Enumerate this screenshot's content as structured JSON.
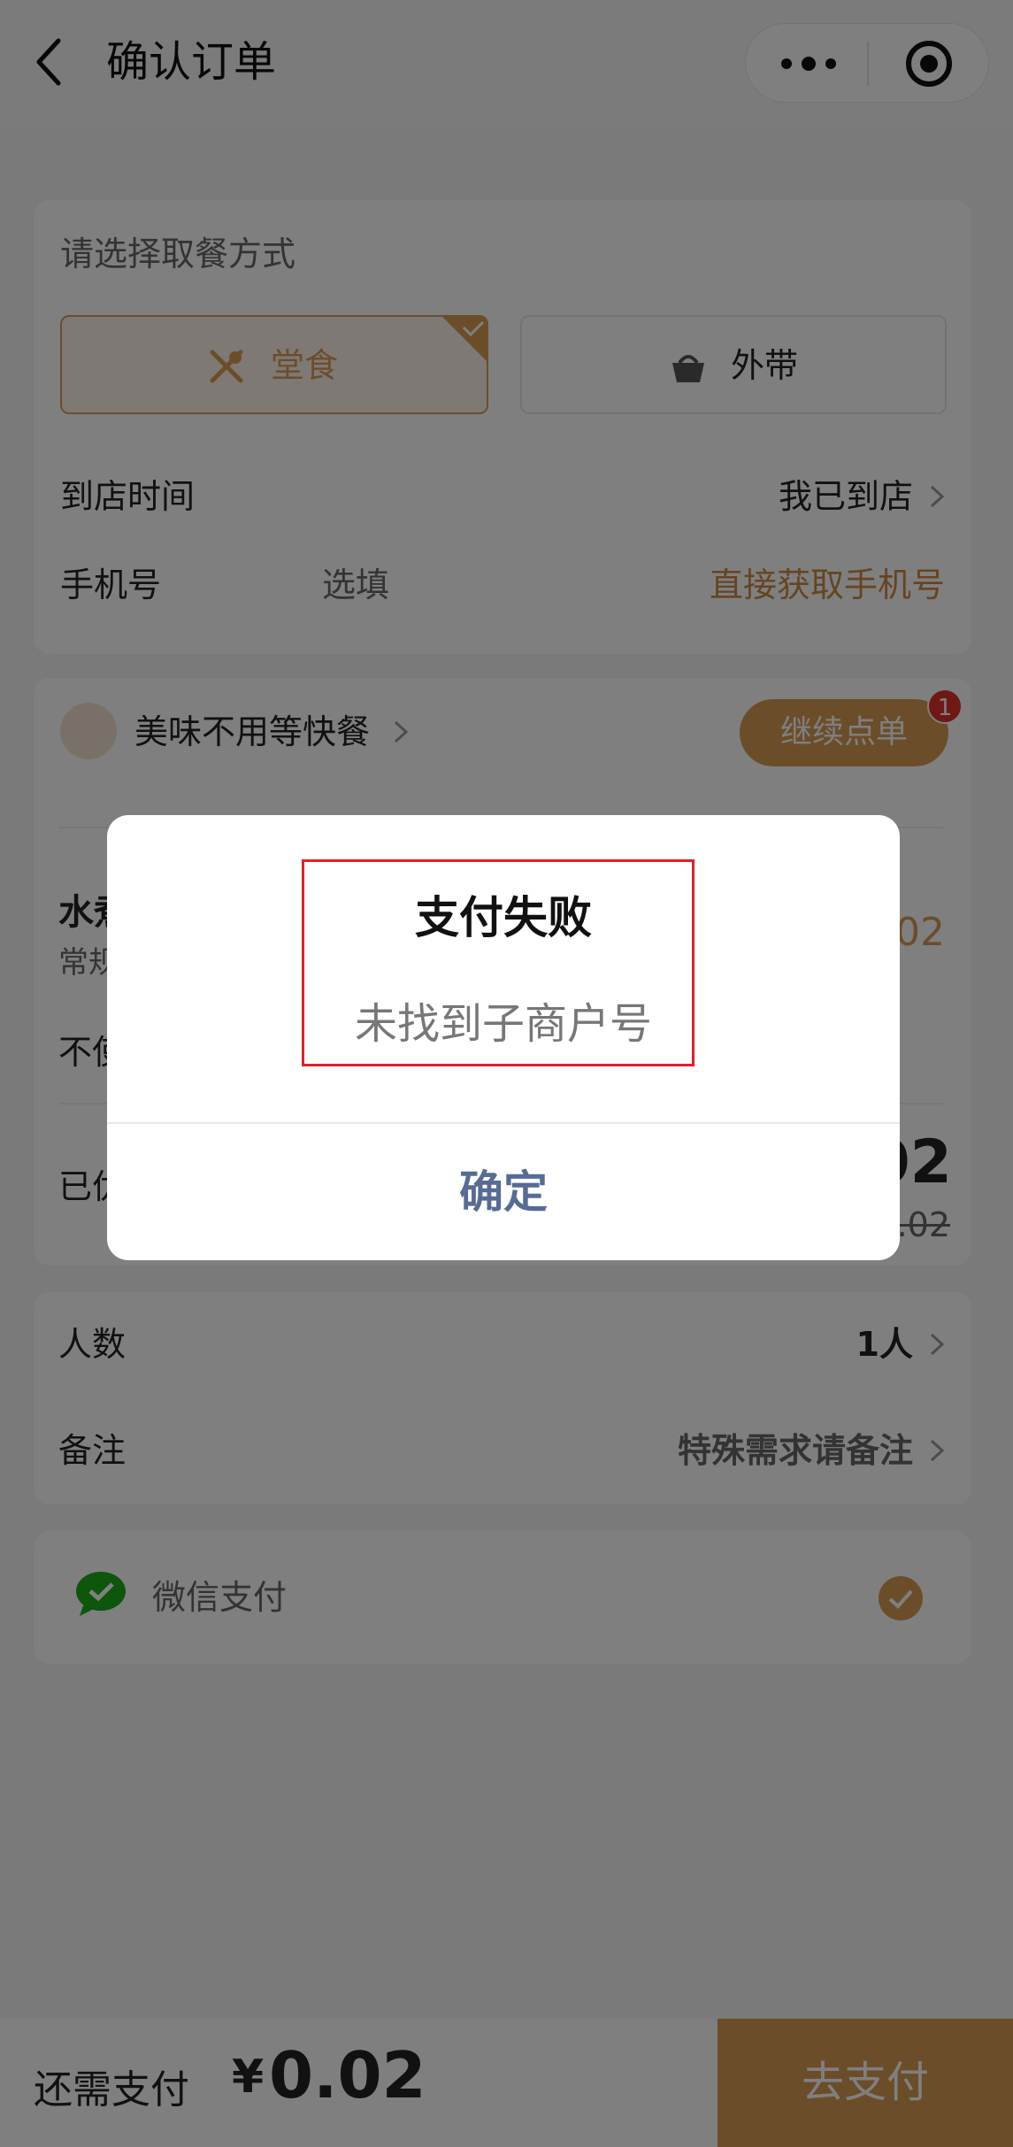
{
  "header": {
    "title": "确认订单"
  },
  "pickup": {
    "heading": "请选择取餐方式",
    "dine_in": "堂食",
    "takeout": "外带",
    "arrival_label": "到店时间",
    "arrival_value": "我已到店",
    "phone_label": "手机号",
    "phone_placeholder": "选填",
    "phone_get": "直接获取手机号"
  },
  "store": {
    "name": "美味不用等快餐",
    "continue_label": "继续点单",
    "badge": "1",
    "item_name_partial": "水煮",
    "item_spec_partial": "常规",
    "item_price_partial": "02",
    "no_partial": "不使",
    "paid_partial": "已优",
    "total_partial": "02",
    "total_original_partial": ".02"
  },
  "extra": {
    "people_label": "人数",
    "people_value": "1人",
    "remark_label": "备注",
    "remark_value": "特殊需求请备注"
  },
  "payment": {
    "method": "微信支付"
  },
  "bottom": {
    "due_label": "还需支付",
    "currency": "¥",
    "amount": "0.02",
    "pay_label": "去支付"
  },
  "dialog": {
    "title": "支付失败",
    "message": "未找到子商户号",
    "confirm": "确定"
  },
  "colors": {
    "accent": "#d99a55",
    "link_orange": "#c98a47",
    "dialog_button": "#576b95",
    "highlight_box": "#e0202a",
    "wechat_green": "#1aad19"
  }
}
